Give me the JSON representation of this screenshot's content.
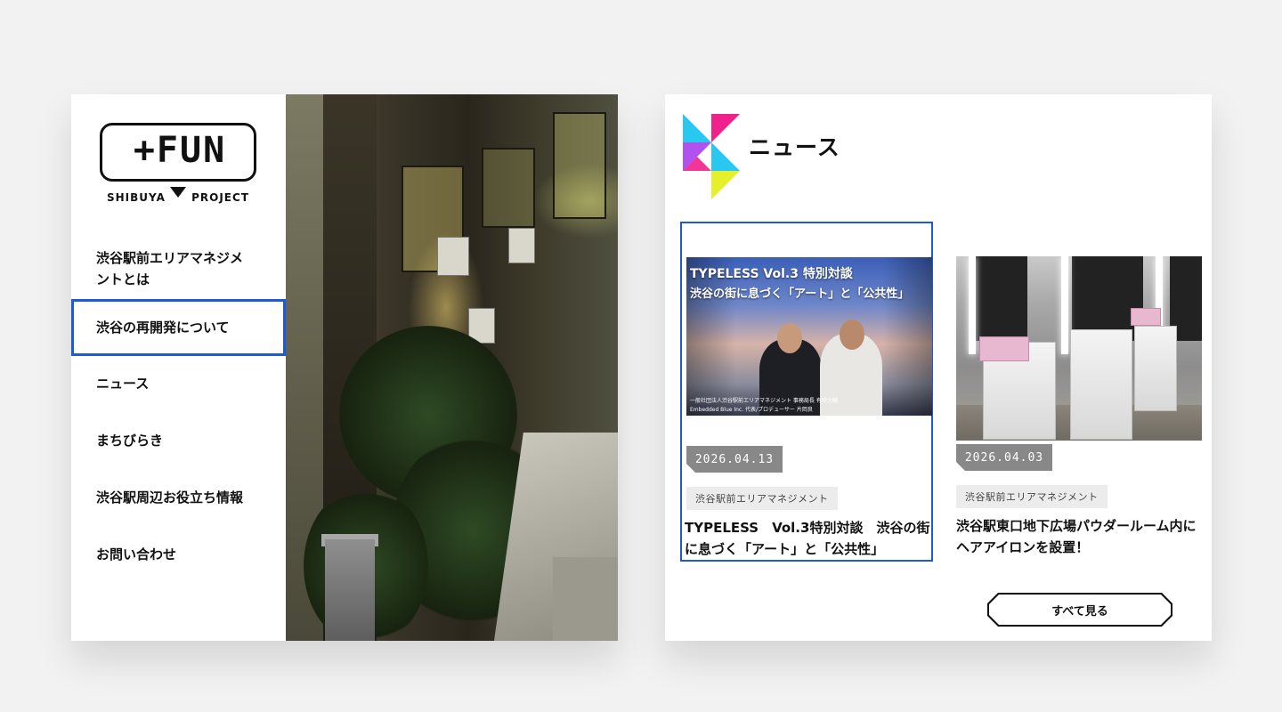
{
  "menu_screen": {
    "logo": {
      "main": "+FUN",
      "left": "SHIBUYA",
      "right": "PROJECT"
    },
    "nav": [
      {
        "label": "渋谷駅前エリアマネジメ\nントとは"
      },
      {
        "label": "渋谷の再開発について",
        "active": true
      },
      {
        "label": "ニュース"
      },
      {
        "label": "まちびらき"
      },
      {
        "label": "渋谷駅周辺お役立ち情報"
      },
      {
        "label": "お問い合わせ"
      }
    ],
    "photo_icon": "night-alley-photo"
  },
  "news_screen": {
    "title": "ニュース",
    "brand_icon": "shibuya-triangle-mark-icon",
    "brand_colors": [
      "#f0208c",
      "#28c8f0",
      "#c83cf0",
      "#e6f028"
    ],
    "selected_outline_color": "#1c5ad6",
    "items": [
      {
        "thumb_line1": "TYPELESS Vol.3 特別対談",
        "thumb_line2": "渋谷の街に息づく「アート」と「公共性」",
        "thumb_caption1": "一般社団法人渋谷駅前エリアマネジメント 事務局長 有時大輔",
        "thumb_caption2": "Embedded Blue Inc. 代表/プロデューサー 片岡良",
        "date": "2026.04.13",
        "category": "渋谷駅前エリアマネジメント",
        "title": "TYPELESS　Vol.3特別対談　渋谷の街に息づく「アート」と「公共性」",
        "selected": true
      },
      {
        "thumb_icon": "powder-room-photo",
        "date": "2026.04.03",
        "category": "渋谷駅前エリアマネジメント",
        "title": "渋谷駅東口地下広場パウダールーム内にヘアアイロンを設置！",
        "selected": false
      }
    ],
    "see_all": "すべて見る"
  }
}
